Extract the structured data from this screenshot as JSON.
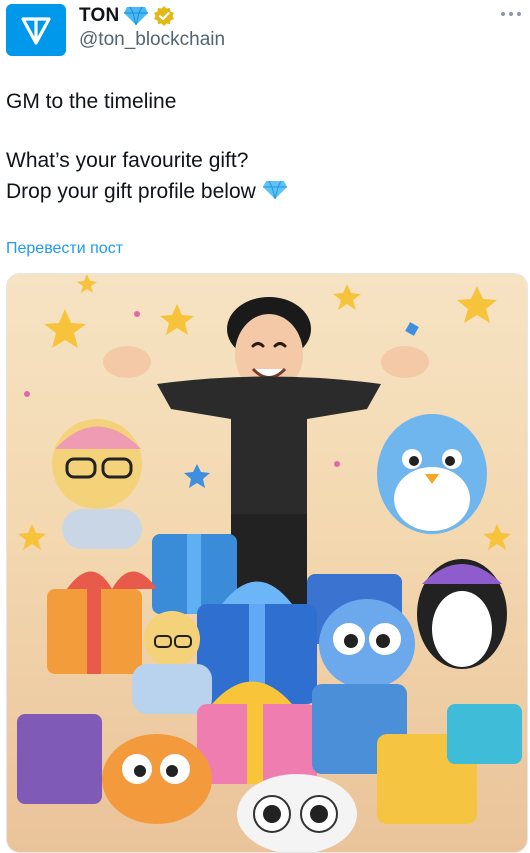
{
  "account": {
    "name": "TON",
    "handle": "@ton_blockchain",
    "verified_badge_icon": "diamond-badge-icon",
    "gold_check_icon": "gold-verified-icon",
    "avatar_icon": "ton-logo-icon"
  },
  "post": {
    "line1": "GM to the timeline",
    "line2": "What’s your favourite gift?",
    "line3": "Drop your gift profile below"
  },
  "translate_label": "Перевести пост",
  "colors": {
    "brand": "#0098ea",
    "link": "#1d9bf0",
    "secondary_text": "#536471"
  }
}
